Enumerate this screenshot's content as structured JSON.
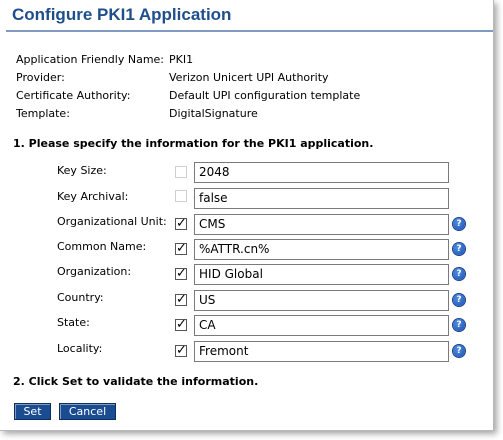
{
  "page": {
    "title": "Configure PKI1 Application"
  },
  "info": [
    {
      "label": "Application Friendly Name:",
      "value": "PKI1"
    },
    {
      "label": "Provider:",
      "value": "Verizon Unicert UPI Authority"
    },
    {
      "label": "Certificate Authority:",
      "value": "Default UPI configuration template"
    },
    {
      "label": "Template:",
      "value": "DigitalSignature"
    }
  ],
  "step1": {
    "text": "1. Please specify the information for the PKI1 application."
  },
  "fields": [
    {
      "label": "Key Size:",
      "checked": false,
      "enabled": false,
      "value": "2048",
      "help": false
    },
    {
      "label": "Key Archival:",
      "checked": false,
      "enabled": false,
      "value": "false",
      "help": false
    },
    {
      "label": "Organizational Unit:",
      "checked": true,
      "enabled": true,
      "value": "CMS",
      "help": true
    },
    {
      "label": "Common Name:",
      "checked": true,
      "enabled": true,
      "value": "%ATTR.cn%",
      "help": true
    },
    {
      "label": "Organization:",
      "checked": true,
      "enabled": true,
      "value": "HID Global",
      "help": true
    },
    {
      "label": "Country:",
      "checked": true,
      "enabled": true,
      "value": "US",
      "help": true
    },
    {
      "label": "State:",
      "checked": true,
      "enabled": true,
      "value": "CA",
      "help": true
    },
    {
      "label": "Locality:",
      "checked": true,
      "enabled": true,
      "value": "Fremont",
      "help": true
    }
  ],
  "step2": {
    "text": "2. Click Set to validate the information."
  },
  "buttons": {
    "set": "Set",
    "cancel": "Cancel"
  },
  "help_icon": {
    "glyph": "?",
    "name": "help-icon",
    "color": "#1b4fb3"
  },
  "check_glyph": "✓",
  "colors": {
    "title": "#1f4e8c",
    "button_bg": "#1a4c91",
    "button_text": "#ffffff"
  }
}
